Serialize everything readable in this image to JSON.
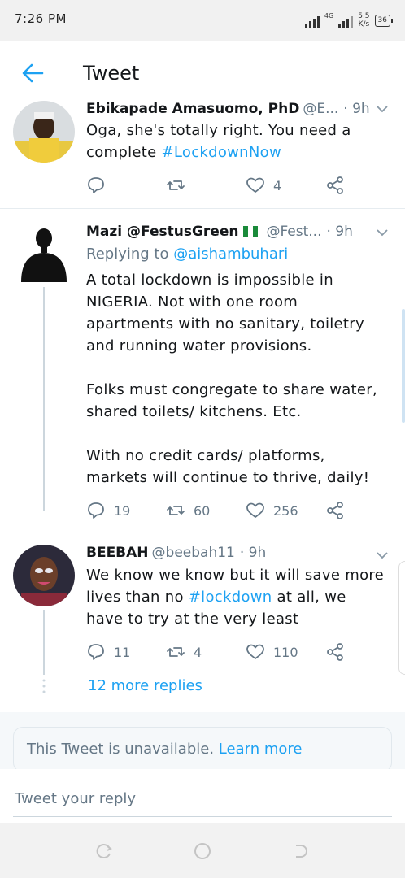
{
  "status_bar": {
    "time": "7:26 PM",
    "network": "4G",
    "speed_value": "5.5",
    "speed_unit": "K/s",
    "battery": "36"
  },
  "header": {
    "title": "Tweet",
    "back_icon": "arrow-left-icon",
    "accent_color": "#1da1f2"
  },
  "tweets": [
    {
      "name": "Ebikapade Amasuomo, PhD",
      "handle": "@E...",
      "time": "· 9h",
      "text_plain": "Oga, she's totally right. You need a complete ",
      "hashtag": "#LockdownNow",
      "actions": {
        "reply": "",
        "retweet": "",
        "like": "4"
      }
    },
    {
      "name": "Mazi @FestusGreen",
      "handle": "@Fest...",
      "time": "· 9h",
      "replying_prefix": "Replying to",
      "replying_to": "@aishambuhari",
      "paragraph1": "A total lockdown is impossible in NIGERIA. Not with one room apartments with no sanitary, toiletry and running water provisions.",
      "paragraph2": "Folks must congregate to share water, shared toilets/ kitchens. Etc.",
      "paragraph3": "With no credit cards/ platforms, markets will continue to thrive, daily!",
      "actions": {
        "reply": "19",
        "retweet": "60",
        "like": "256"
      }
    },
    {
      "name": "BEEBAH",
      "handle": "@beebah11",
      "time": "· 9h",
      "text_before": "We know we know but it will save more lives than no ",
      "hashtag": "#lockdown",
      "text_after": " at all, we have to try at the very least",
      "actions": {
        "reply": "11",
        "retweet": "4",
        "like": "110"
      }
    }
  ],
  "more_replies": "12 more replies",
  "unavailable": {
    "text": "This Tweet is unavailable.",
    "link": "Learn more"
  },
  "reply_input": {
    "placeholder": "Tweet your reply"
  }
}
